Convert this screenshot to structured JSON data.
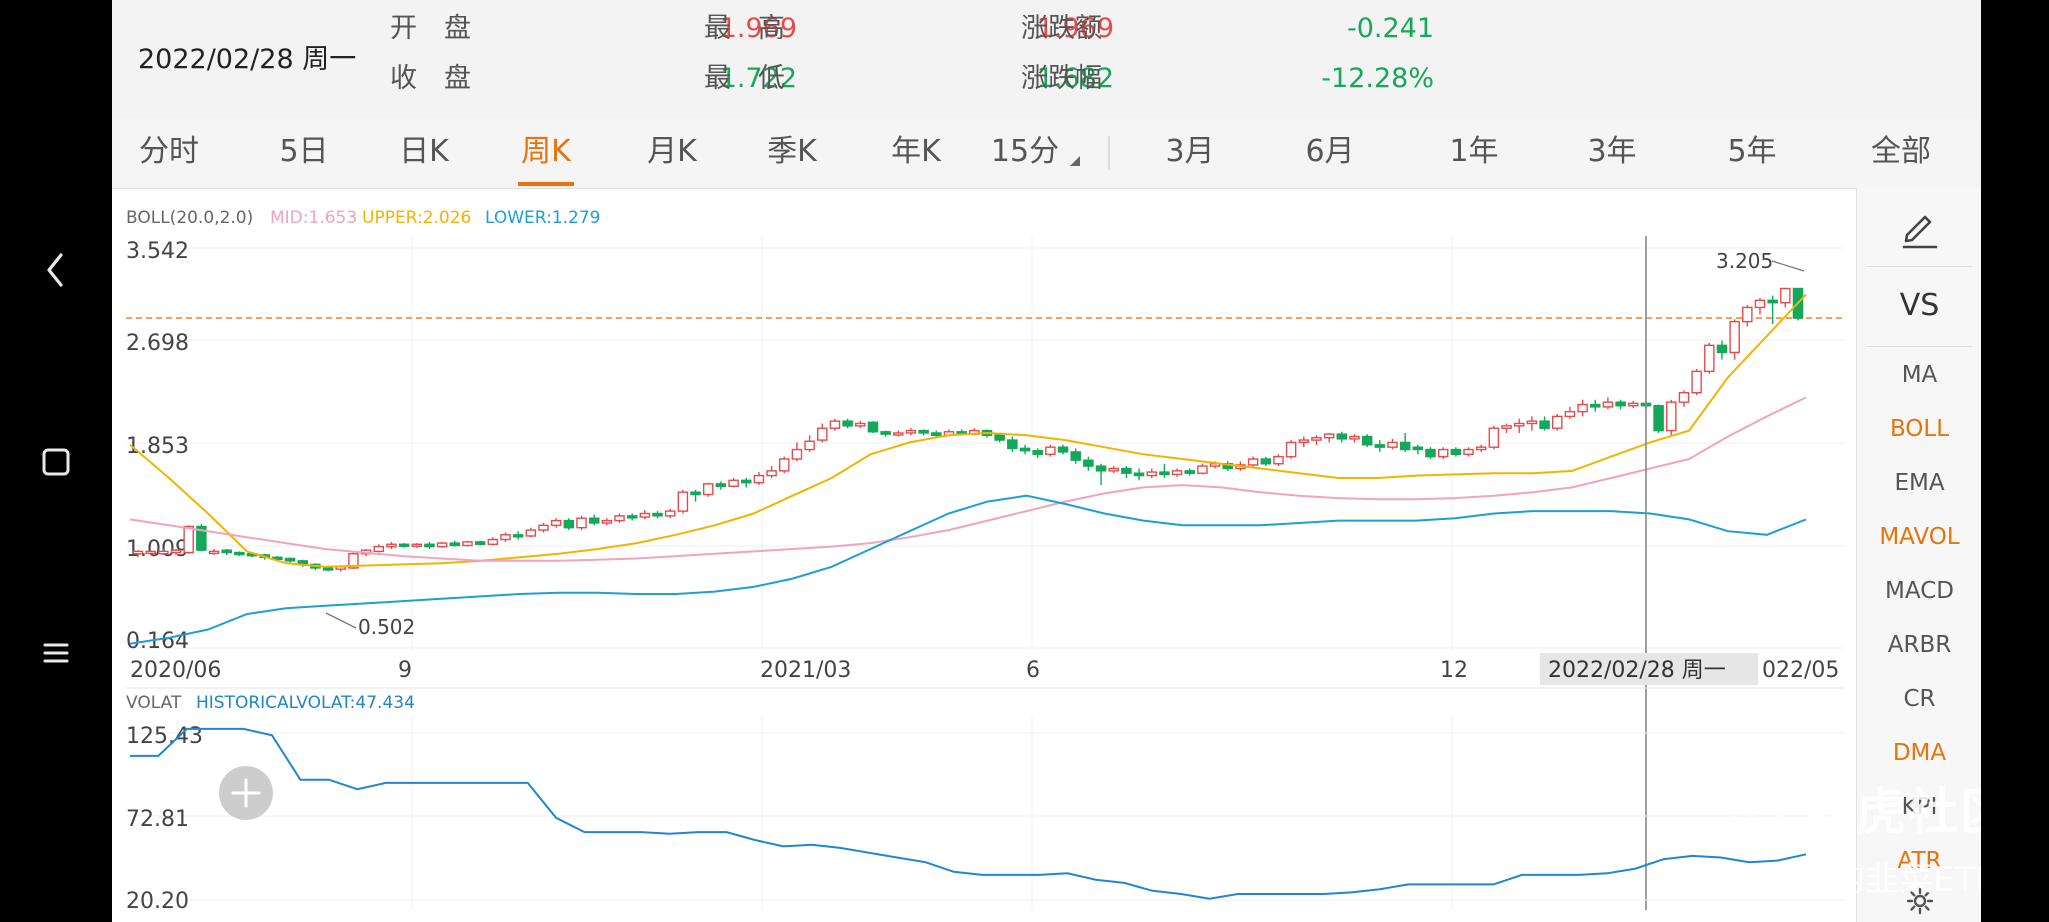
{
  "quote": {
    "date": "2022/02/28 周一",
    "open_label": "开　盘",
    "open_value": "1.969",
    "high_label": "最　高",
    "high_value": "1.969",
    "change_label": "涨跌额",
    "change_value": "-0.241",
    "close_label": "收　盘",
    "close_value": "1.722",
    "low_label": "最　低",
    "low_value": "1.682",
    "pct_label": "涨跌幅",
    "pct_value": "-12.28%"
  },
  "tabs": [
    "分时",
    "5日",
    "日K",
    "周K",
    "月K",
    "季K",
    "年K",
    "15分",
    "3月",
    "6月",
    "1年",
    "3年",
    "5年",
    "全部"
  ],
  "active_tab": "周K",
  "indicators": {
    "boll": {
      "name": "BOLL(20.0,2.0)",
      "mid": "MID:1.653",
      "upper": "UPPER:2.026",
      "lower": "LOWER:1.279"
    },
    "volat": {
      "name": "VOLAT",
      "value": "HISTORICALVOLAT:47.434"
    }
  },
  "side_menu": {
    "vs_label": "VS",
    "items": [
      "MA",
      "BOLL",
      "EMA",
      "MAVOL",
      "MACD",
      "ARBR",
      "CR",
      "DMA",
      "KPI",
      "ATR"
    ],
    "active": [
      "BOLL",
      "MAVOL",
      "DMA",
      "ATR"
    ]
  },
  "watermark": {
    "brand": "老虎社区",
    "user": "@冷静的韭菜ETF"
  },
  "colors": {
    "up": "#e84a4a",
    "down": "#13a85a",
    "upper": "#f2b400",
    "mid": "#f0a4bd",
    "lower": "#1e9fd4",
    "volat": "#1f86d4",
    "accent": "#e8730c"
  },
  "chart_data": [
    {
      "type": "candlestick",
      "ylim": [
        0.164,
        3.542
      ],
      "yticks": [
        "3.542",
        "2.698",
        "1.853",
        "1.009",
        "0.164"
      ],
      "x_labels": [
        "2020/06",
        "9",
        "2021/03",
        "6",
        "12",
        "022/05"
      ],
      "crosshair_label": "2022/02/28 周一",
      "max_label": "3.205",
      "min_label": "0.502",
      "reference_close": 2.95,
      "series": [
        {
          "name": "MID",
          "values": [
            1.25,
            1.2,
            1.15,
            1.1,
            1.05,
            1.0,
            0.97,
            0.94,
            0.92,
            0.9,
            0.9,
            0.9,
            0.91,
            0.92,
            0.94,
            0.96,
            0.98,
            1.0,
            1.02,
            1.05,
            1.1,
            1.16,
            1.24,
            1.32,
            1.4,
            1.47,
            1.52,
            1.54,
            1.52,
            1.48,
            1.45,
            1.43,
            1.42,
            1.42,
            1.43,
            1.45,
            1.48,
            1.52,
            1.6,
            1.68,
            1.76,
            1.95,
            2.12,
            2.28
          ]
        },
        {
          "name": "UPPER",
          "values": [
            1.88,
            1.6,
            1.3,
            0.98,
            0.88,
            0.85,
            0.86,
            0.87,
            0.88,
            0.9,
            0.93,
            0.96,
            1.0,
            1.05,
            1.12,
            1.2,
            1.3,
            1.45,
            1.6,
            1.8,
            1.9,
            1.96,
            1.98,
            1.96,
            1.92,
            1.86,
            1.8,
            1.76,
            1.72,
            1.68,
            1.64,
            1.6,
            1.6,
            1.62,
            1.63,
            1.64,
            1.64,
            1.66,
            1.78,
            1.9,
            2.0,
            2.45,
            2.8,
            3.15
          ]
        },
        {
          "name": "LOWER",
          "values": [
            0.2,
            0.25,
            0.32,
            0.45,
            0.5,
            0.52,
            0.54,
            0.56,
            0.58,
            0.6,
            0.62,
            0.63,
            0.63,
            0.62,
            0.62,
            0.64,
            0.68,
            0.75,
            0.85,
            1.0,
            1.15,
            1.3,
            1.4,
            1.45,
            1.38,
            1.3,
            1.24,
            1.2,
            1.2,
            1.2,
            1.22,
            1.24,
            1.24,
            1.24,
            1.26,
            1.3,
            1.32,
            1.32,
            1.32,
            1.3,
            1.25,
            1.15,
            1.12,
            1.25
          ]
        }
      ],
      "candles": [
        [
          0.96,
          0.98,
          0.93,
          0.99
        ],
        [
          0.97,
          0.98,
          0.95,
          0.99
        ],
        [
          0.96,
          0.98,
          0.95,
          1.0
        ],
        [
          0.97,
          0.99,
          0.95,
          1.0
        ],
        [
          0.97,
          1.19,
          0.96,
          1.2
        ],
        [
          1.19,
          0.99,
          0.98,
          1.21
        ],
        [
          0.98,
          0.98,
          0.95,
          1.0
        ],
        [
          0.99,
          0.97,
          0.95,
          1.0
        ],
        [
          0.97,
          0.96,
          0.94,
          0.98
        ],
        [
          0.96,
          0.95,
          0.93,
          0.97
        ],
        [
          0.95,
          0.93,
          0.91,
          0.96
        ],
        [
          0.93,
          0.92,
          0.9,
          0.94
        ],
        [
          0.92,
          0.9,
          0.88,
          0.93
        ],
        [
          0.9,
          0.87,
          0.85,
          0.91
        ],
        [
          0.87,
          0.84,
          0.82,
          0.88
        ],
        [
          0.84,
          0.83,
          0.81,
          0.86
        ],
        [
          0.83,
          0.85,
          0.81,
          0.86
        ],
        [
          0.84,
          0.96,
          0.83,
          0.97
        ],
        [
          0.96,
          0.99,
          0.94,
          1.0
        ],
        [
          0.98,
          1.02,
          0.97,
          1.04
        ],
        [
          1.02,
          1.04,
          1.0,
          1.06
        ],
        [
          1.04,
          1.03,
          1.01,
          1.05
        ],
        [
          1.03,
          1.04,
          1.01,
          1.05
        ],
        [
          1.04,
          1.02,
          1.0,
          1.06
        ],
        [
          1.02,
          1.05,
          1.01,
          1.06
        ],
        [
          1.05,
          1.03,
          1.02,
          1.07
        ],
        [
          1.03,
          1.06,
          1.02,
          1.07
        ],
        [
          1.06,
          1.04,
          1.03,
          1.07
        ],
        [
          1.04,
          1.08,
          1.03,
          1.1
        ],
        [
          1.08,
          1.12,
          1.06,
          1.14
        ],
        [
          1.12,
          1.11,
          1.08,
          1.15
        ],
        [
          1.11,
          1.16,
          1.1,
          1.18
        ],
        [
          1.16,
          1.2,
          1.14,
          1.22
        ],
        [
          1.2,
          1.24,
          1.18,
          1.26
        ],
        [
          1.24,
          1.18,
          1.16,
          1.26
        ],
        [
          1.18,
          1.26,
          1.16,
          1.28
        ],
        [
          1.26,
          1.22,
          1.2,
          1.29
        ],
        [
          1.22,
          1.24,
          1.2,
          1.26
        ],
        [
          1.24,
          1.28,
          1.22,
          1.3
        ],
        [
          1.28,
          1.27,
          1.24,
          1.3
        ],
        [
          1.27,
          1.3,
          1.25,
          1.33
        ],
        [
          1.3,
          1.28,
          1.26,
          1.32
        ],
        [
          1.28,
          1.32,
          1.26,
          1.34
        ],
        [
          1.32,
          1.48,
          1.3,
          1.5
        ],
        [
          1.48,
          1.46,
          1.4,
          1.5
        ],
        [
          1.46,
          1.55,
          1.44,
          1.56
        ],
        [
          1.55,
          1.53,
          1.5,
          1.57
        ],
        [
          1.53,
          1.58,
          1.52,
          1.6
        ],
        [
          1.58,
          1.56,
          1.52,
          1.6
        ],
        [
          1.56,
          1.62,
          1.54,
          1.65
        ],
        [
          1.62,
          1.66,
          1.6,
          1.7
        ],
        [
          1.66,
          1.76,
          1.64,
          1.78
        ],
        [
          1.76,
          1.84,
          1.74,
          1.9
        ],
        [
          1.84,
          1.91,
          1.82,
          1.96
        ],
        [
          1.92,
          2.02,
          1.9,
          2.06
        ],
        [
          2.02,
          2.08,
          2.0,
          2.1
        ],
        [
          2.08,
          2.04,
          2.02,
          2.1
        ],
        [
          2.04,
          2.06,
          2.02,
          2.08
        ],
        [
          2.07,
          1.99,
          1.98,
          2.08
        ],
        [
          1.99,
          1.97,
          1.95,
          2.0
        ],
        [
          1.97,
          1.98,
          1.95,
          2.0
        ],
        [
          1.98,
          2.0,
          1.96,
          2.02
        ],
        [
          2.0,
          1.98,
          1.96,
          2.01
        ],
        [
          1.98,
          1.96,
          1.95,
          2.0
        ],
        [
          1.96,
          1.99,
          1.95,
          2.01
        ],
        [
          1.99,
          1.97,
          1.96,
          2.01
        ],
        [
          1.97,
          2.0,
          1.96,
          2.02
        ],
        [
          2.0,
          1.96,
          1.94,
          2.01
        ],
        [
          1.97,
          1.92,
          1.9,
          1.98
        ],
        [
          1.92,
          1.85,
          1.82,
          1.95
        ],
        [
          1.85,
          1.83,
          1.8,
          1.88
        ],
        [
          1.83,
          1.8,
          1.77,
          1.85
        ],
        [
          1.8,
          1.86,
          1.78,
          1.88
        ],
        [
          1.86,
          1.82,
          1.8,
          1.88
        ],
        [
          1.82,
          1.75,
          1.72,
          1.85
        ],
        [
          1.75,
          1.7,
          1.66,
          1.78
        ],
        [
          1.7,
          1.66,
          1.54,
          1.72
        ],
        [
          1.66,
          1.68,
          1.64,
          1.7
        ],
        [
          1.68,
          1.64,
          1.6,
          1.7
        ],
        [
          1.64,
          1.62,
          1.58,
          1.68
        ],
        [
          1.62,
          1.65,
          1.6,
          1.68
        ],
        [
          1.65,
          1.63,
          1.6,
          1.72
        ],
        [
          1.63,
          1.66,
          1.61,
          1.68
        ],
        [
          1.66,
          1.64,
          1.62,
          1.68
        ],
        [
          1.64,
          1.7,
          1.63,
          1.72
        ],
        [
          1.7,
          1.72,
          1.68,
          1.74
        ],
        [
          1.72,
          1.68,
          1.66,
          1.74
        ],
        [
          1.68,
          1.71,
          1.66,
          1.74
        ],
        [
          1.71,
          1.76,
          1.68,
          1.78
        ],
        [
          1.76,
          1.72,
          1.7,
          1.78
        ],
        [
          1.72,
          1.78,
          1.7,
          1.8
        ],
        [
          1.78,
          1.9,
          1.76,
          1.92
        ],
        [
          1.9,
          1.92,
          1.86,
          1.95
        ],
        [
          1.92,
          1.94,
          1.88,
          1.96
        ],
        [
          1.94,
          1.97,
          1.9,
          1.98
        ],
        [
          1.97,
          1.93,
          1.9,
          1.99
        ],
        [
          1.93,
          1.95,
          1.9,
          1.97
        ],
        [
          1.95,
          1.88,
          1.86,
          1.97
        ],
        [
          1.88,
          1.86,
          1.82,
          1.92
        ],
        [
          1.86,
          1.9,
          1.84,
          1.93
        ],
        [
          1.9,
          1.84,
          1.82,
          1.98
        ],
        [
          1.86,
          1.84,
          1.8,
          1.88
        ],
        [
          1.84,
          1.78,
          1.76,
          1.86
        ],
        [
          1.78,
          1.84,
          1.76,
          1.86
        ],
        [
          1.84,
          1.8,
          1.78,
          1.86
        ],
        [
          1.8,
          1.84,
          1.78,
          1.86
        ],
        [
          1.84,
          1.86,
          1.82,
          1.88
        ],
        [
          1.86,
          2.02,
          1.84,
          2.04
        ],
        [
          2.02,
          2.04,
          1.98,
          2.06
        ],
        [
          2.04,
          2.06,
          1.98,
          2.1
        ],
        [
          2.06,
          2.08,
          2.0,
          2.12
        ],
        [
          2.08,
          2.02,
          2.0,
          2.12
        ],
        [
          2.02,
          2.12,
          2.0,
          2.14
        ],
        [
          2.12,
          2.16,
          2.1,
          2.2
        ],
        [
          2.16,
          2.22,
          2.12,
          2.26
        ],
        [
          2.22,
          2.2,
          2.16,
          2.26
        ],
        [
          2.2,
          2.24,
          2.18,
          2.28
        ],
        [
          2.24,
          2.21,
          2.18,
          2.26
        ],
        [
          2.21,
          2.23,
          2.19,
          2.25
        ],
        [
          2.23,
          2.21,
          2.18,
          2.25
        ],
        [
          2.21,
          2.0,
          1.98,
          2.22
        ],
        [
          2.0,
          2.24,
          1.96,
          2.26
        ],
        [
          2.24,
          2.32,
          2.2,
          2.34
        ],
        [
          2.32,
          2.5,
          2.3,
          2.52
        ],
        [
          2.5,
          2.72,
          2.48,
          2.74
        ],
        [
          2.72,
          2.66,
          2.6,
          2.76
        ],
        [
          2.66,
          2.92,
          2.6,
          2.94
        ],
        [
          2.92,
          3.04,
          2.88,
          3.06
        ],
        [
          3.04,
          3.1,
          2.98,
          3.12
        ],
        [
          3.1,
          3.08,
          2.9,
          3.14
        ],
        [
          3.08,
          3.2,
          3.04,
          3.205
        ],
        [
          3.2,
          2.95,
          2.93,
          3.2
        ]
      ]
    },
    {
      "type": "line",
      "name": "HISTORICALVOLAT",
      "ylim": [
        20.2,
        125.43
      ],
      "yticks": [
        "125.43",
        "72.81",
        "20.20"
      ],
      "values": [
        111,
        111,
        128,
        128,
        128,
        124,
        96,
        96,
        90,
        94,
        94,
        94,
        94,
        94,
        94,
        72,
        63,
        63,
        63,
        62,
        63,
        63,
        58,
        54,
        55,
        53,
        50,
        47,
        44,
        38,
        36,
        36,
        36,
        37,
        33,
        31,
        26,
        24,
        21,
        24,
        24,
        24,
        24,
        25,
        27,
        30,
        30,
        30,
        30,
        36,
        36,
        36,
        37,
        40,
        46,
        48,
        47,
        44,
        45,
        49
      ]
    }
  ]
}
